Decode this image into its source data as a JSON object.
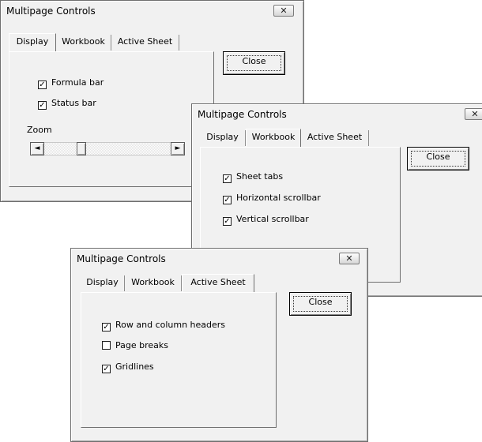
{
  "dialogs": [
    {
      "title": "Multipage Controls",
      "tabs": [
        "Display",
        "Workbook",
        "Active Sheet"
      ],
      "active_tab": "Display",
      "close_label": "Close",
      "checkboxes": [
        {
          "label": "Formula bar",
          "checked": true
        },
        {
          "label": "Status bar",
          "checked": true
        }
      ],
      "zoom_label": "Zoom"
    },
    {
      "title": "Multipage Controls",
      "tabs": [
        "Display",
        "Workbook",
        "Active Sheet"
      ],
      "active_tab": "Workbook",
      "close_label": "Close",
      "checkboxes": [
        {
          "label": "Sheet tabs",
          "checked": true
        },
        {
          "label": "Horizontal scrollbar",
          "checked": true
        },
        {
          "label": "Vertical scrollbar",
          "checked": true
        }
      ]
    },
    {
      "title": "Multipage Controls",
      "tabs": [
        "Display",
        "Workbook",
        "Active Sheet"
      ],
      "active_tab": "Active Sheet",
      "close_label": "Close",
      "checkboxes": [
        {
          "label": "Row and column headers",
          "checked": true
        },
        {
          "label": "Page breaks",
          "checked": false
        },
        {
          "label": "Gridlines",
          "checked": true
        }
      ]
    }
  ],
  "icons": {
    "close": "✕",
    "scroll_left": "◄",
    "scroll_right": "►",
    "check": "✓"
  }
}
